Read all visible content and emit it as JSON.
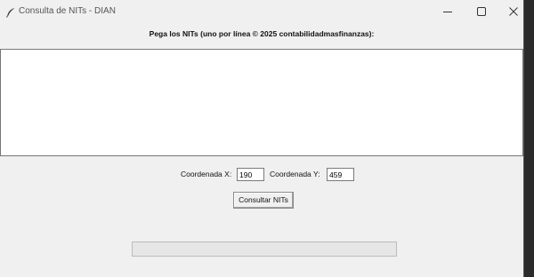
{
  "window": {
    "title": "Consulta de NITs - DIAN",
    "app_icon": "feather-icon",
    "controls": [
      "minimize-icon",
      "maximize-icon",
      "close-icon"
    ]
  },
  "form": {
    "instruction": "Pega los NITs (uno por línea © 2025 contabilidadmasfinanzas):",
    "nits_text": "",
    "coord_x_label": "Coordenada X:",
    "coord_x_value": "190",
    "coord_y_label": "Coordenada Y:",
    "coord_y_value": "459",
    "submit_label": "Consultar NITs"
  },
  "progress": {
    "value": 0
  }
}
